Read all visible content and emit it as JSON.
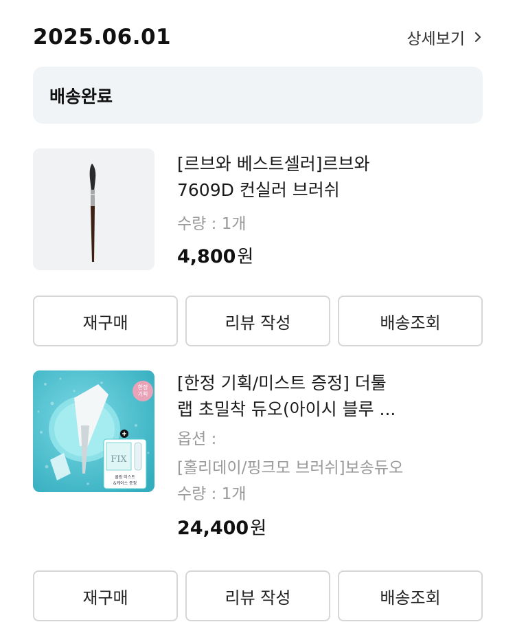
{
  "order": {
    "date": "2025.06.01",
    "detail_label": "상세보기",
    "status": "배송완료"
  },
  "items": [
    {
      "title_line1": "[르브와 베스트셀러]르브와",
      "title_line2": "7609D 컨실러 브러쉬",
      "quantity": "수량 : 1개",
      "price": "4,800",
      "currency": "원",
      "buttons": {
        "rebuy": "재구매",
        "review": "리뷰 작성",
        "tracking": "배송조회"
      }
    },
    {
      "title_line1": "[한정 기획/미스트 증정] 더툴",
      "title_line2": "랩 초밀착 듀오(아이시 블루 ...",
      "option_label": "옵션 :",
      "option_value": "[홀리데이/핑크모 브러쉬]보송듀오",
      "quantity": "수량 : 1개",
      "price": "24,400",
      "currency": "원",
      "badge": [
        "한정",
        "기획"
      ],
      "product_text": [
        "FIX",
        "쿨링 미스트",
        "&케이스 증정"
      ],
      "buttons": {
        "rebuy": "재구매",
        "review": "리뷰 작성",
        "tracking": "배송조회"
      }
    }
  ],
  "icons": {
    "detail": "chevron-right-icon"
  },
  "colors": {
    "status_bg": "#f1f4f6",
    "muted_text": "#9a9a9a",
    "button_border": "#d6d6d6",
    "product2_bg": "#53c3d3"
  }
}
